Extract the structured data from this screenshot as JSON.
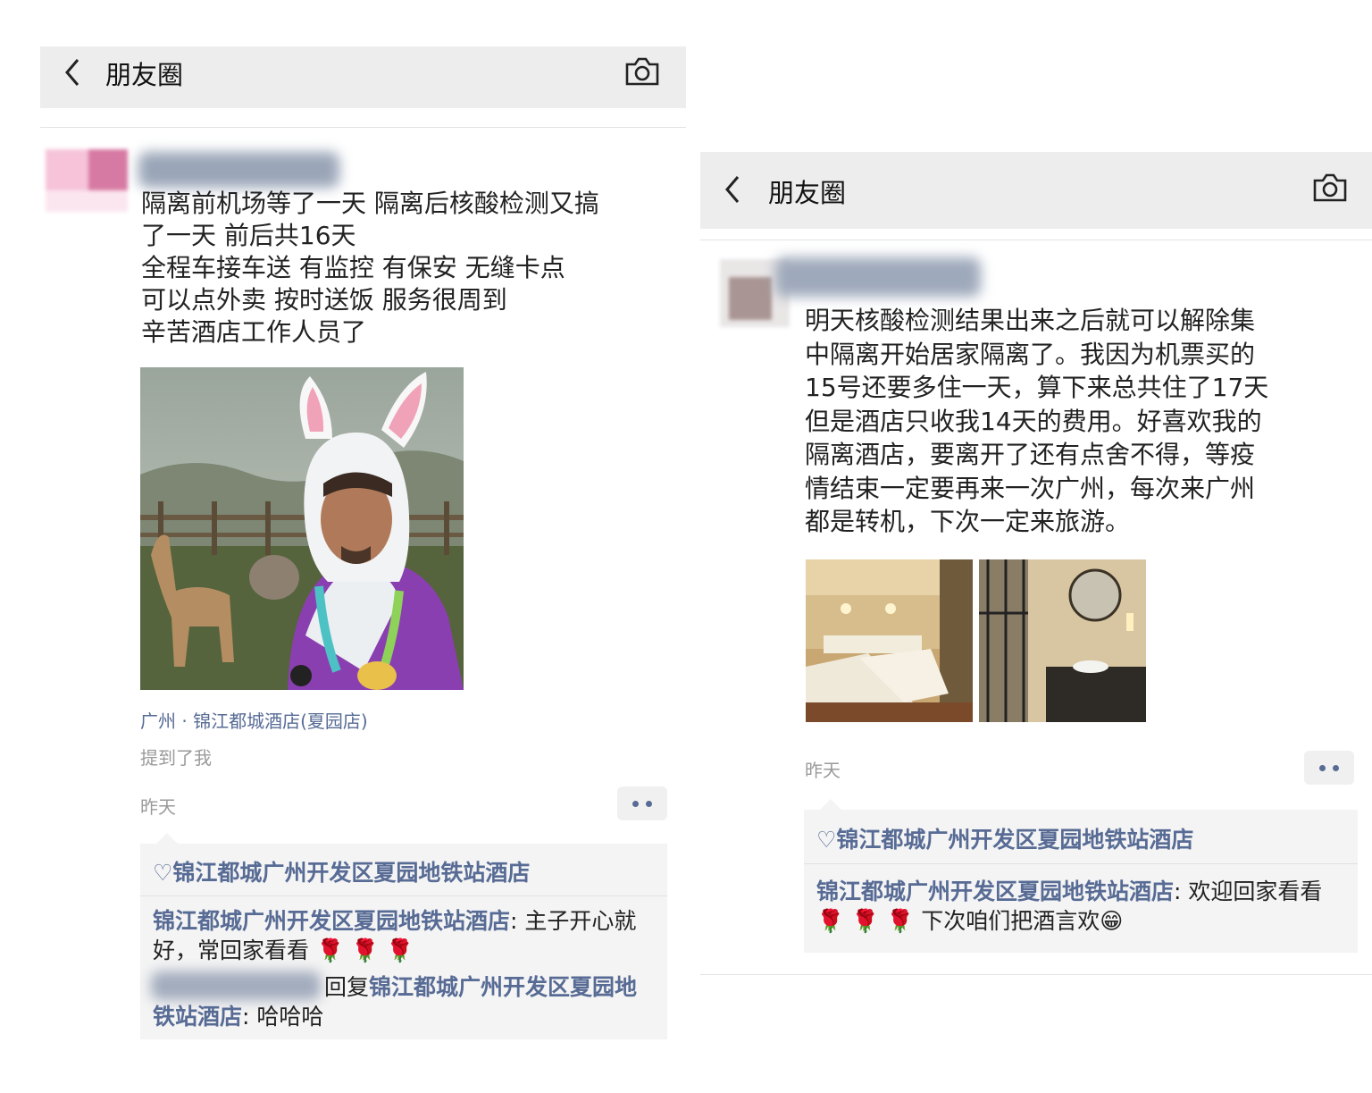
{
  "left": {
    "header": {
      "title": "朋友圈"
    },
    "post": {
      "text": "隔离前机场等了一天 隔离后核酸检测又搞\n了一天  前后共16天\n全程车接车送 有监控 有保安 无缝卡点\n可以点外卖 按时送饭 服务很周到\n辛苦酒店工作人员了",
      "location": "广州 · 锦江都城酒店(夏园店)",
      "mention": "提到了我",
      "time": "昨天",
      "likes": "♡锦江都城广州开发区夏园地铁站酒店",
      "comments": [
        {
          "name": "锦江都城广州开发区夏园地铁站酒店",
          "sep": ": ",
          "text": "主子开心就好，常回家看看",
          "emoji": "🌹 🌹 🌹"
        },
        {
          "reply_label": "回复",
          "name": "锦江都城广州开发区夏园地铁站酒店",
          "sep": ": ",
          "text": "哈哈哈"
        }
      ]
    }
  },
  "right": {
    "header": {
      "title": "朋友圈"
    },
    "post": {
      "text": "明天核酸检测结果出来之后就可以解除集\n中隔离开始居家隔离了。我因为机票买的\n15号还要多住一天，算下来总共住了17天\n但是酒店只收我14天的费用。好喜欢我的\n隔离酒店，要离开了还有点舍不得，等疫\n情结束一定要再来一次广州，每次来广州\n都是转机，下次一定来旅游。",
      "time": "昨天",
      "likes": "♡锦江都城广州开发区夏园地铁站酒店",
      "comments": [
        {
          "name": "锦江都城广州开发区夏园地铁站酒店",
          "sep": ": ",
          "text_a": "欢迎回家看看",
          "emoji": "🌹 🌹 🌹",
          "text_b": "下次咱们把酒言欢",
          "emoji2": "😁"
        }
      ]
    }
  },
  "icons": {
    "back": "back-chevron-icon",
    "camera": "camera-icon",
    "more": "more-dots-icon",
    "like": "heart-icon"
  }
}
